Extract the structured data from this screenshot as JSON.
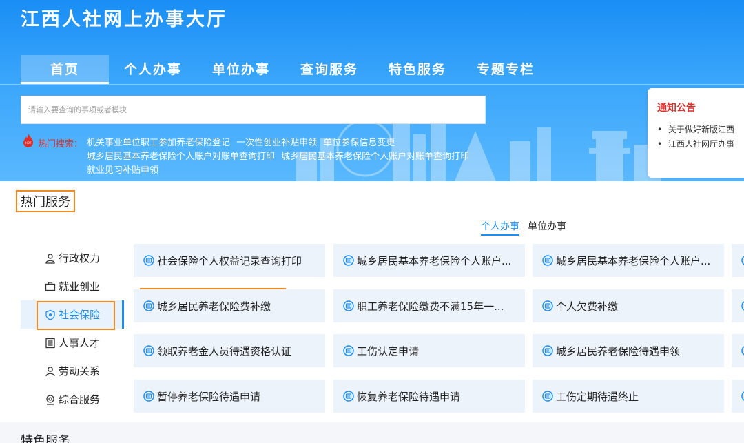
{
  "site": {
    "title": "江西人社网上办事大厅"
  },
  "nav": {
    "items": [
      "首页",
      "个人办事",
      "单位办事",
      "查询服务",
      "特色服务",
      "专题专栏"
    ]
  },
  "search": {
    "placeholder": "请输入要查询的事项或者模块"
  },
  "hot_search": {
    "label": "热门搜索：",
    "links": [
      "机关事业单位职工参加养老保险登记",
      "一次性创业补贴申领",
      "单位参保信息变更",
      "城乡居民基本养老保险个人账户对账单查询打印",
      "城乡居民基本养老保险个人账户对账单查询打印",
      "就业见习补贴申领"
    ]
  },
  "notice": {
    "title": "通知公告",
    "items": [
      "关于做好新版江西",
      "江西人社网厅办事"
    ]
  },
  "hot_services": {
    "title": "热门服务",
    "tabs": [
      "个人办事",
      "单位办事"
    ],
    "categories": [
      "行政权力",
      "就业创业",
      "社会保险",
      "人事人才",
      "劳动关系",
      "综合服务"
    ],
    "cards": [
      [
        "社会保险个人权益记录查询打印",
        "城乡居民基本养老保险个人账户...",
        "城乡居民基本养老保险个人账户..."
      ],
      [
        "城乡居民养老保险费补缴",
        "职工养老保险缴费不满15年一...",
        "个人欠费补缴"
      ],
      [
        "领取养老金人员待遇资格认证",
        "工伤认定申请",
        "城乡居民养老保险待遇申领"
      ],
      [
        "暂停养老保险待遇申请",
        "恢复养老保险待遇申请",
        "工伤定期待遇终止"
      ]
    ]
  },
  "featured": {
    "title": "特色服务"
  },
  "colors": {
    "brand": "#1a8ef5",
    "highlight": "#f08a22",
    "hot": "#d9302c"
  }
}
